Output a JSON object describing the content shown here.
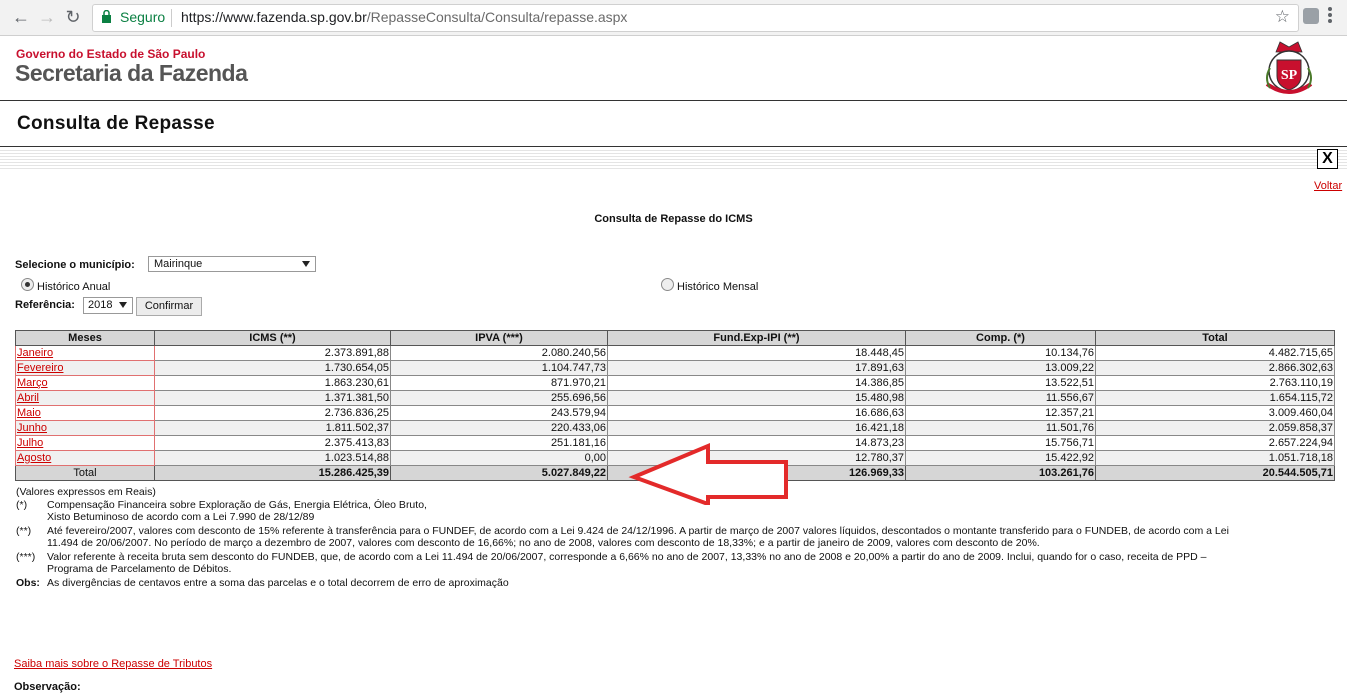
{
  "browser": {
    "secure_label": "Seguro",
    "url_host": "https://www.fazenda.sp.gov.br",
    "url_path": "/RepasseConsulta/Consulta/repasse.aspx"
  },
  "header": {
    "gov_text": "Governo do Estado de São Paulo",
    "sec_text": "Secretaria da Fazenda",
    "page_title": "Consulta de Repasse"
  },
  "toolbar": {
    "close_label": "X",
    "voltar_label": "Voltar"
  },
  "content": {
    "title": "Consulta de Repasse do ICMS",
    "municipio_label": "Selecione o município:",
    "municipio_value": "Mairinque",
    "radio_anual": "Histórico Anual",
    "radio_mensal": "Histórico Mensal",
    "referencia_label": "Referência:",
    "referencia_value": "2018",
    "confirm_label": "Confirmar"
  },
  "table": {
    "headers": [
      "Meses",
      "ICMS (**)",
      "IPVA (***)",
      "Fund.Exp-IPI (**)",
      "Comp. (*)",
      "Total"
    ],
    "rows": [
      [
        "Janeiro",
        "2.373.891,88",
        "2.080.240,56",
        "18.448,45",
        "10.134,76",
        "4.482.715,65"
      ],
      [
        "Fevereiro",
        "1.730.654,05",
        "1.104.747,73",
        "17.891,63",
        "13.009,22",
        "2.866.302,63"
      ],
      [
        "Março",
        "1.863.230,61",
        "871.970,21",
        "14.386,85",
        "13.522,51",
        "2.763.110,19"
      ],
      [
        "Abril",
        "1.371.381,50",
        "255.696,56",
        "15.480,98",
        "11.556,67",
        "1.654.115,72"
      ],
      [
        "Maio",
        "2.736.836,25",
        "243.579,94",
        "16.686,63",
        "12.357,21",
        "3.009.460,04"
      ],
      [
        "Junho",
        "1.811.502,37",
        "220.433,06",
        "16.421,18",
        "11.501,76",
        "2.059.858,37"
      ],
      [
        "Julho",
        "2.375.413,83",
        "251.181,16",
        "14.873,23",
        "15.756,71",
        "2.657.224,94"
      ],
      [
        "Agosto",
        "1.023.514,88",
        "0,00",
        "12.780,37",
        "15.422,92",
        "1.051.718,18"
      ]
    ],
    "total": [
      "Total",
      "15.286.425,39",
      "5.027.849,22",
      "126.969,33",
      "103.261,76",
      "20.544.505,71"
    ]
  },
  "notes": {
    "values_note": "(Valores expressos em Reais)",
    "n1_mark": "(*)",
    "n1_line1": "Compensação Financeira sobre Exploração de Gás, Energia Elétrica, Óleo Bruto,",
    "n1_line2": "Xisto Betuminoso de acordo com a Lei 7.990 de 28/12/89",
    "n2_mark": "(**)",
    "n2_line1": "Até fevereiro/2007, valores com desconto de 15% referente à transferência para o FUNDEF, de acordo com a Lei 9.424 de 24/12/1996. A partir de março de 2007 valores líquidos, descontados o montante transferido para o FUNDEB, de acordo com a Lei",
    "n2_line2": "11.494 de 20/06/2007. No período de março a dezembro de 2007, valores com desconto de 16,66%; no ano de 2008, valores com desconto de 18,33%; e a partir de janeiro de 2009, valores com desconto de 20%.",
    "n3_mark": "(***)",
    "n3_line1": "Valor referente à receita bruta sem desconto do FUNDEB, que, de acordo com a Lei 11.494 de 20/06/2007, corresponde a 6,66% no ano de 2007, 13,33% no ano de 2008 e 20,00% a partir do ano de 2009. Inclui, quando for o caso, receita de PPD –",
    "n3_line2": "Programa de Parcelamento de Débitos.",
    "obs_mark": "Obs:",
    "obs_text": "As divergências de centavos entre a soma das parcelas e o total decorrem de erro de aproximação"
  },
  "footer": {
    "saiba_label": "Saiba mais sobre o Repasse de Tributos",
    "observacao_label": "Observação:"
  },
  "colors": {
    "accent_red": "#c00000",
    "gov_red": "#c8102e",
    "header_gray": "#d6d6d6",
    "annotation_arrow": "#e32a2a"
  },
  "icons": [
    "back-arrow-icon",
    "forward-arrow-icon",
    "reload-icon",
    "lock-icon",
    "star-icon",
    "extension-icon",
    "menu-icon",
    "sp-seal-icon",
    "close-icon",
    "red-arrow-annotation"
  ]
}
